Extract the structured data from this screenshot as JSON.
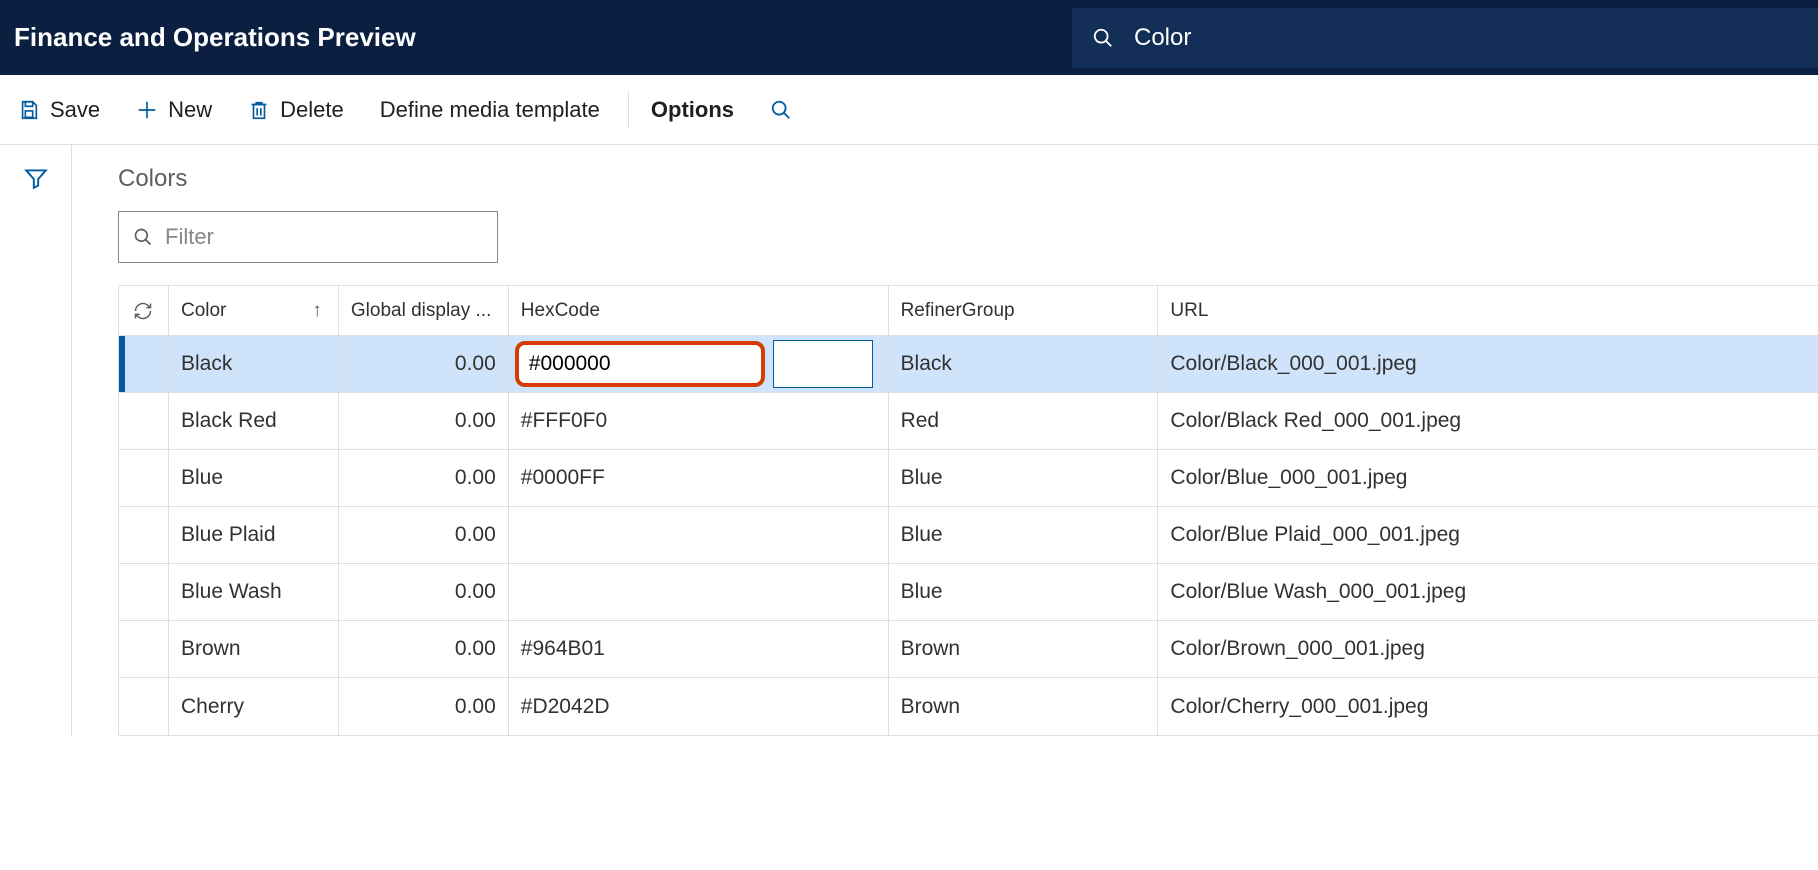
{
  "header": {
    "title": "Finance and Operations Preview",
    "search_value": "Color"
  },
  "commands": {
    "save": "Save",
    "new": "New",
    "delete": "Delete",
    "define_media_template": "Define media template",
    "options": "Options"
  },
  "page": {
    "title": "Colors",
    "filter_placeholder": "Filter"
  },
  "grid": {
    "columns": {
      "color": "Color",
      "global_display_order": "Global display ...",
      "hexcode": "HexCode",
      "refiner_group": "RefinerGroup",
      "url": "URL"
    },
    "rows": [
      {
        "color": "Black",
        "gdo": "0.00",
        "hex": "#000000",
        "refiner": "Black",
        "url": "Color/Black_000_001.jpeg",
        "selected": true,
        "editing": true
      },
      {
        "color": "Black Red",
        "gdo": "0.00",
        "hex": "#FFF0F0",
        "refiner": "Red",
        "url": "Color/Black Red_000_001.jpeg",
        "selected": false,
        "editing": false
      },
      {
        "color": "Blue",
        "gdo": "0.00",
        "hex": "#0000FF",
        "refiner": "Blue",
        "url": "Color/Blue_000_001.jpeg",
        "selected": false,
        "editing": false
      },
      {
        "color": "Blue Plaid",
        "gdo": "0.00",
        "hex": "",
        "refiner": "Blue",
        "url": "Color/Blue Plaid_000_001.jpeg",
        "selected": false,
        "editing": false
      },
      {
        "color": "Blue Wash",
        "gdo": "0.00",
        "hex": "",
        "refiner": "Blue",
        "url": "Color/Blue Wash_000_001.jpeg",
        "selected": false,
        "editing": false
      },
      {
        "color": "Brown",
        "gdo": "0.00",
        "hex": "#964B01",
        "refiner": "Brown",
        "url": "Color/Brown_000_001.jpeg",
        "selected": false,
        "editing": false
      },
      {
        "color": "Cherry",
        "gdo": "0.00",
        "hex": "#D2042D",
        "refiner": "Brown",
        "url": "Color/Cherry_000_001.jpeg",
        "selected": false,
        "editing": false
      }
    ]
  }
}
